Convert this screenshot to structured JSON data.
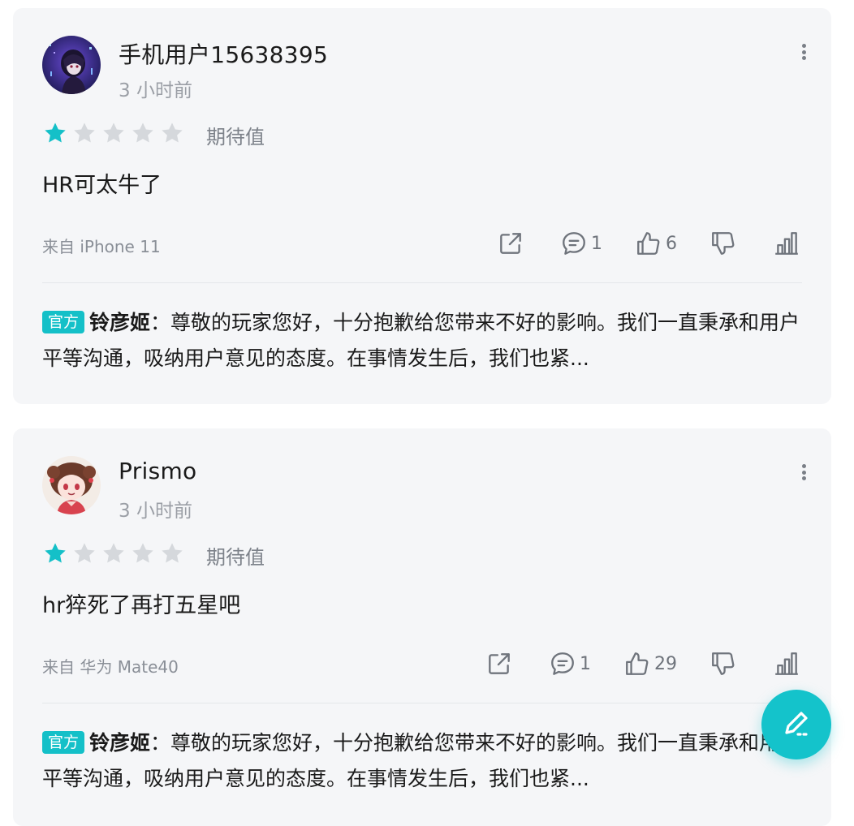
{
  "reviews": [
    {
      "username": "手机用户15638395",
      "time": "3 小时前",
      "rating": 1,
      "rating_label": "期待值",
      "content": "HR可太牛了",
      "device": "来自 iPhone 11",
      "comments": "1",
      "likes": "6",
      "reply": {
        "badge": "官方",
        "author": "铃彦姬",
        "separator": "：",
        "text": "尊敬的玩家您好，十分抱歉给您带来不好的影响。我们一直秉承和用户平等沟通，吸纳用户意见的态度。在事情发生后，我们也紧..."
      }
    },
    {
      "username": "Prismo",
      "time": "3 小时前",
      "rating": 1,
      "rating_label": "期待值",
      "content": "hr猝死了再打五星吧",
      "device": "来自 华为 Mate40",
      "comments": "1",
      "likes": "29",
      "reply": {
        "badge": "官方",
        "author": "铃彦姬",
        "separator": "：",
        "text": "尊敬的玩家您好，十分抱歉给您带来不好的影响。我们一直秉承和用户平等沟通，吸纳用户意见的态度。在事情发生后，我们也紧..."
      }
    }
  ],
  "icons": {
    "star": "star-icon",
    "share": "share-icon",
    "comment": "comment-icon",
    "like": "thumbs-up-icon",
    "dislike": "thumbs-down-icon",
    "stats": "bar-chart-icon",
    "more": "more-vertical-icon",
    "write": "pen-icon"
  },
  "colors": {
    "accent": "#14c0c8",
    "star_filled": "#14c0c8",
    "star_empty": "#d5d8dc",
    "card_bg": "#f5f6f8"
  }
}
